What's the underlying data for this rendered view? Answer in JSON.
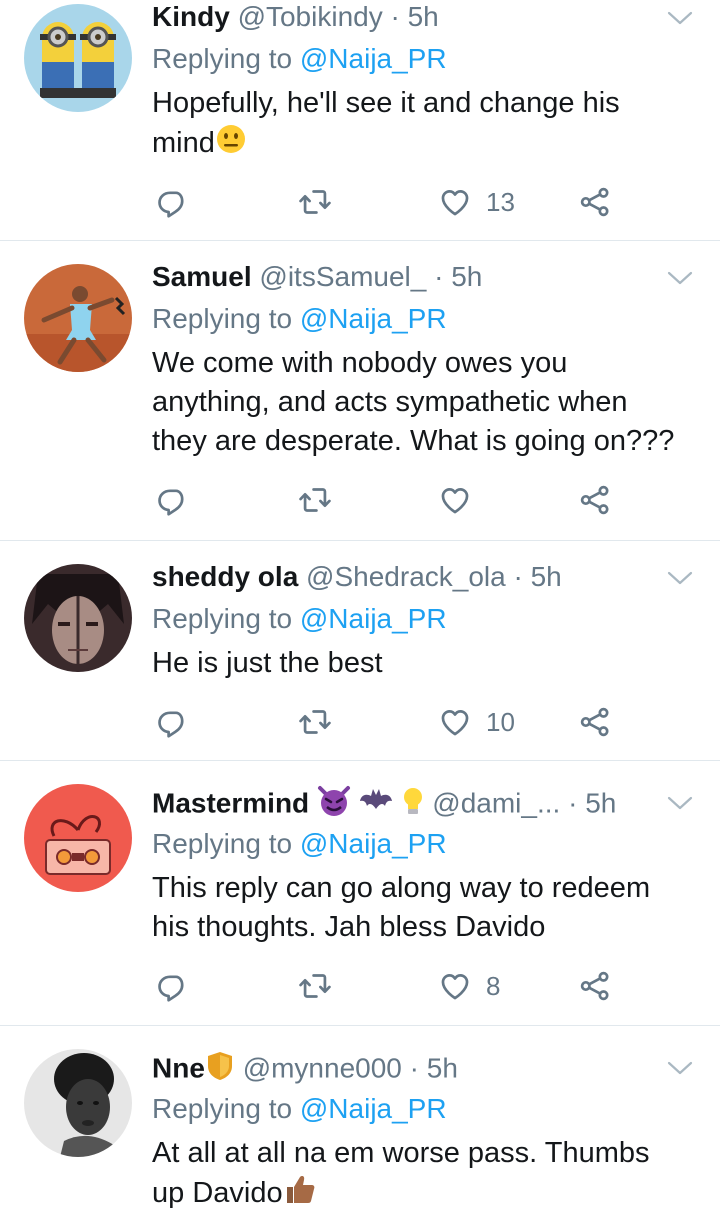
{
  "colors": {
    "link": "#1da1f2",
    "secondary": "#657786",
    "text": "#14171a",
    "divider": "#e1e8ed"
  },
  "tweets": [
    {
      "name": "Kindy",
      "handle": "@Tobikindy",
      "time": "· 5h",
      "reply_prefix": "Replying to",
      "reply_to": "@Naija_PR",
      "text_lines": [
        "Hopefully, he'll see it and change his",
        "mind"
      ],
      "name_emoji": "",
      "text_emoji": "neutral-face-icon",
      "likes": "13",
      "avatar": "minions-avatar"
    },
    {
      "name": "Samuel",
      "handle": "@itsSamuel_",
      "time": "· 5h",
      "reply_prefix": "Replying to",
      "reply_to": "@Naija_PR",
      "text_lines": [
        "We come with nobody owes you",
        "anything, and acts sympathetic when",
        "they are desperate. What is going on???"
      ],
      "likes": "",
      "avatar": "tennis-player-avatar"
    },
    {
      "name": "sheddy ola",
      "handle": "@Shedrack_ola",
      "time": "· 5h",
      "reply_prefix": "Replying to",
      "reply_to": "@Naija_PR",
      "text_lines": [
        "He is just the best"
      ],
      "likes": "10",
      "avatar": "anime-character-avatar"
    },
    {
      "name": "Mastermind",
      "handle": "@dami_...",
      "time": "· 5h",
      "reply_prefix": "Replying to",
      "reply_to": "@Naija_PR",
      "text_lines": [
        "This reply can go along way to redeem",
        "his thoughts. Jah bless Davido"
      ],
      "name_emoji": "devil-bat-bulb-icons",
      "likes": "8",
      "avatar": "cassette-heart-avatar"
    },
    {
      "name": "Nne",
      "handle": "@mynne000",
      "time": "· 5h",
      "reply_prefix": "Replying to",
      "reply_to": "@Naija_PR",
      "text_lines": [
        "At all at all na em worse pass.  Thumbs",
        "up Davido"
      ],
      "name_emoji": "shield-icon",
      "text_emoji": "thumbs-up-icon",
      "likes": "",
      "avatar": "woman-bw-avatar"
    }
  ]
}
